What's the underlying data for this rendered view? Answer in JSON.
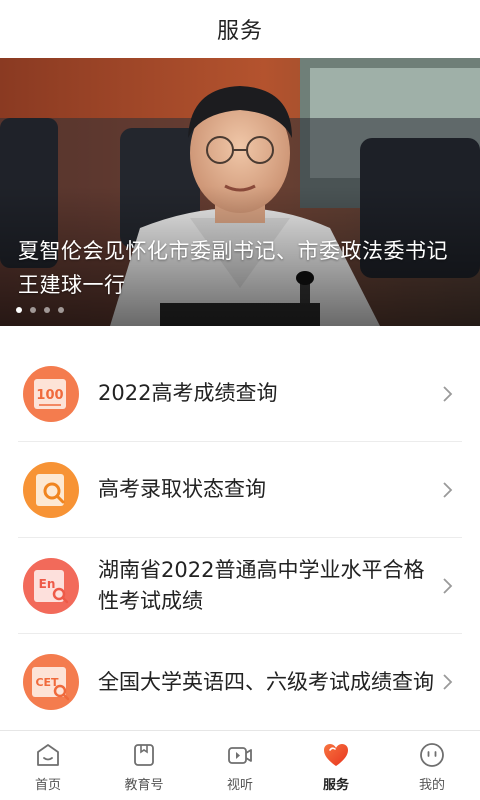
{
  "header": {
    "title": "服务"
  },
  "banner": {
    "caption": "夏智伦会见怀化市委副书记、市委政法委书记王建球一行",
    "slide_count": 4,
    "active_slide": 0
  },
  "services": [
    {
      "label": "2022高考成绩查询",
      "icon": "score-100-icon",
      "icon_text": "100",
      "color": "#f47c4e"
    },
    {
      "label": "高考录取状态查询",
      "icon": "document-search-icon",
      "color": "#f79335"
    },
    {
      "label": "湖南省2022普通高中学业水平合格性考试成绩",
      "icon": "english-search-icon",
      "icon_text": "En",
      "color": "#f26a5a"
    },
    {
      "label": "全国大学英语四、六级考试成绩查询",
      "icon": "cet-search-icon",
      "icon_text": "CET",
      "color": "#f47c4e"
    }
  ],
  "tabbar": {
    "items": [
      {
        "label": "首页",
        "icon": "home-icon"
      },
      {
        "label": "教育号",
        "icon": "book-icon"
      },
      {
        "label": "视听",
        "icon": "video-icon"
      },
      {
        "label": "服务",
        "icon": "heart-icon",
        "active": true
      },
      {
        "label": "我的",
        "icon": "smiley-icon"
      }
    ]
  },
  "colors": {
    "accent": "#f0532d",
    "text": "#222222",
    "divider": "#ececec"
  }
}
